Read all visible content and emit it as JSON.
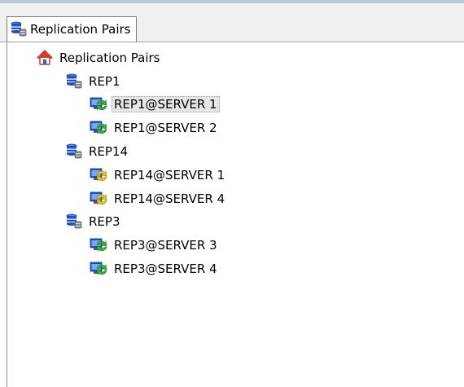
{
  "tab": {
    "label": "Replication Pairs",
    "icon": "database-stack-icon"
  },
  "tree": {
    "root": {
      "label": "Replication Pairs",
      "icon": "home-icon"
    },
    "groups": [
      {
        "label": "REP1",
        "icon": "database-stack-icon",
        "children": [
          {
            "label": "REP1@SERVER 1",
            "icon": "replication-sync-icon",
            "status": "green",
            "selected": true
          },
          {
            "label": "REP1@SERVER 2",
            "icon": "replication-sync-icon",
            "status": "green",
            "selected": false
          }
        ]
      },
      {
        "label": "REP14",
        "icon": "database-stack-icon",
        "children": [
          {
            "label": "REP14@SERVER 1",
            "icon": "replication-sync-icon",
            "status": "yellow",
            "selected": false
          },
          {
            "label": "REP14@SERVER 4",
            "icon": "replication-sync-icon",
            "status": "yellow",
            "selected": false
          }
        ]
      },
      {
        "label": "REP3",
        "icon": "database-stack-icon",
        "children": [
          {
            "label": "REP3@SERVER 3",
            "icon": "replication-sync-icon",
            "status": "green",
            "selected": false
          },
          {
            "label": "REP3@SERVER 4",
            "icon": "replication-sync-icon",
            "status": "green",
            "selected": false
          }
        ]
      }
    ]
  },
  "colors": {
    "sync_green": "#2fb33a",
    "sync_yellow": "#e8c81a",
    "db_blue": "#1f4fc9",
    "home_red": "#d63a2a"
  }
}
